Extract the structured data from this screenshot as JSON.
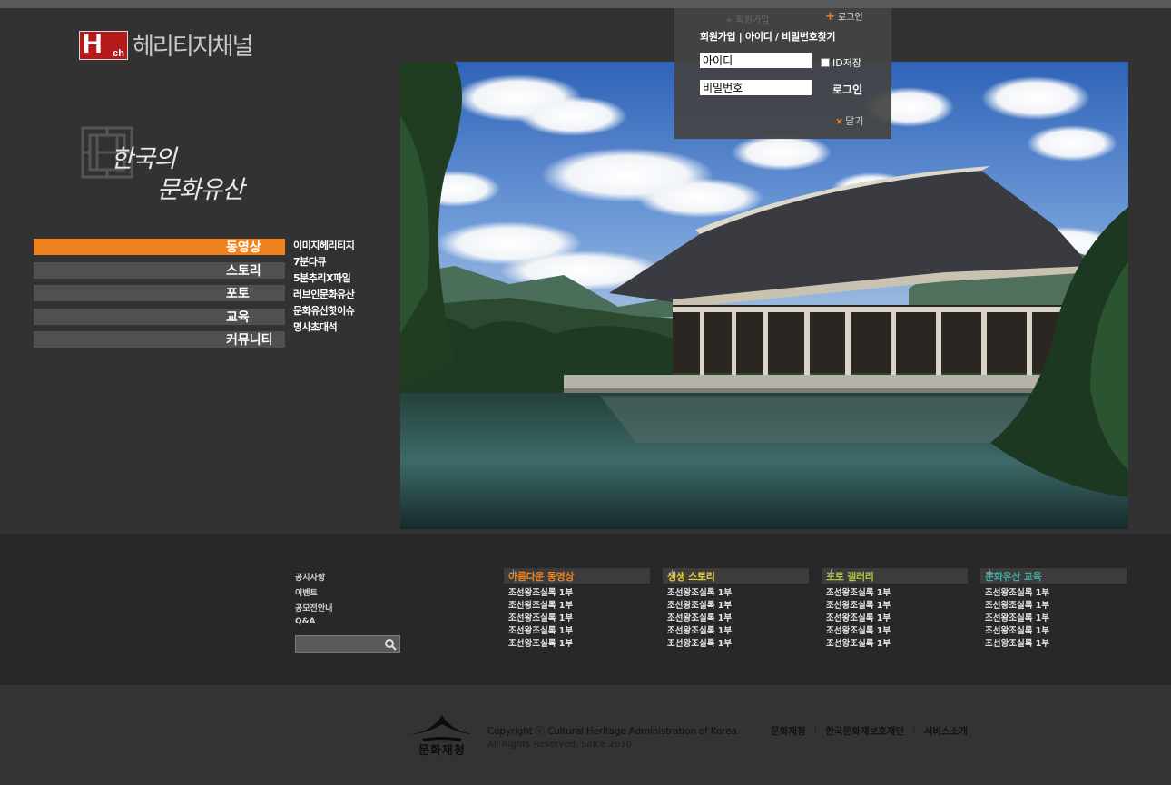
{
  "brand": {
    "logo_main": "H",
    "logo_sub": "ch",
    "name": "헤리티지채널"
  },
  "title_art": {
    "line1": "한국의",
    "line2": "문화유산"
  },
  "nav": [
    {
      "label": "동영상",
      "active": true
    },
    {
      "label": "스토리",
      "active": false
    },
    {
      "label": "포토",
      "active": false
    },
    {
      "label": "교육",
      "active": false
    },
    {
      "label": "커뮤니티",
      "active": false
    }
  ],
  "subnav": [
    "이미지헤리티지",
    "7분다큐",
    "5분추리X파일",
    "러브인문화유산",
    "문화유산핫이슈",
    "명사초대석"
  ],
  "login": {
    "faded_text": "+ 회원가입",
    "top_link": "로그인",
    "links": "회원가입 | 아이디 / 비밀번호찾기",
    "id_placeholder": "아이디",
    "pw_placeholder": "비밀번호",
    "save_id": "ID저장",
    "button": "로그인",
    "close": "닫기"
  },
  "quick_links": [
    "공지사항",
    "이벤트",
    "공모전안내",
    "Q&A"
  ],
  "columns": [
    {
      "title": "아름다운 동영상",
      "color": "#f0821d",
      "items": [
        "조선왕조실록 1부",
        "조선왕조실록 1부",
        "조선왕조실록 1부",
        "조선왕조실록 1부",
        "조선왕조실록 1부"
      ]
    },
    {
      "title": "생생 스토리",
      "color": "#e6d23a",
      "items": [
        "조선왕조실록 1부",
        "조선왕조실록 1부",
        "조선왕조실록 1부",
        "조선왕조실록 1부",
        "조선왕조실록 1부"
      ]
    },
    {
      "title": "포토 갤러리",
      "color": "#a8c640",
      "items": [
        "조선왕조실록 1부",
        "조선왕조실록 1부",
        "조선왕조실록 1부",
        "조선왕조실록 1부",
        "조선왕조실록 1부"
      ]
    },
    {
      "title": "문화유산 교육",
      "color": "#3fa8a0",
      "items": [
        "조선왕조실록 1부",
        "조선왕조실록 1부",
        "조선왕조실록 1부",
        "조선왕조실록 1부",
        "조선왕조실록 1부"
      ]
    }
  ],
  "footer": {
    "logo_text": "문화재청",
    "copyright": "Copyright ⓒ Cultural Heritage Administration of Korea.",
    "rights": "All Rights Reserved. Since 2010",
    "links": [
      "문화재청",
      "한국문화재보호재단",
      "서비스소개"
    ]
  }
}
